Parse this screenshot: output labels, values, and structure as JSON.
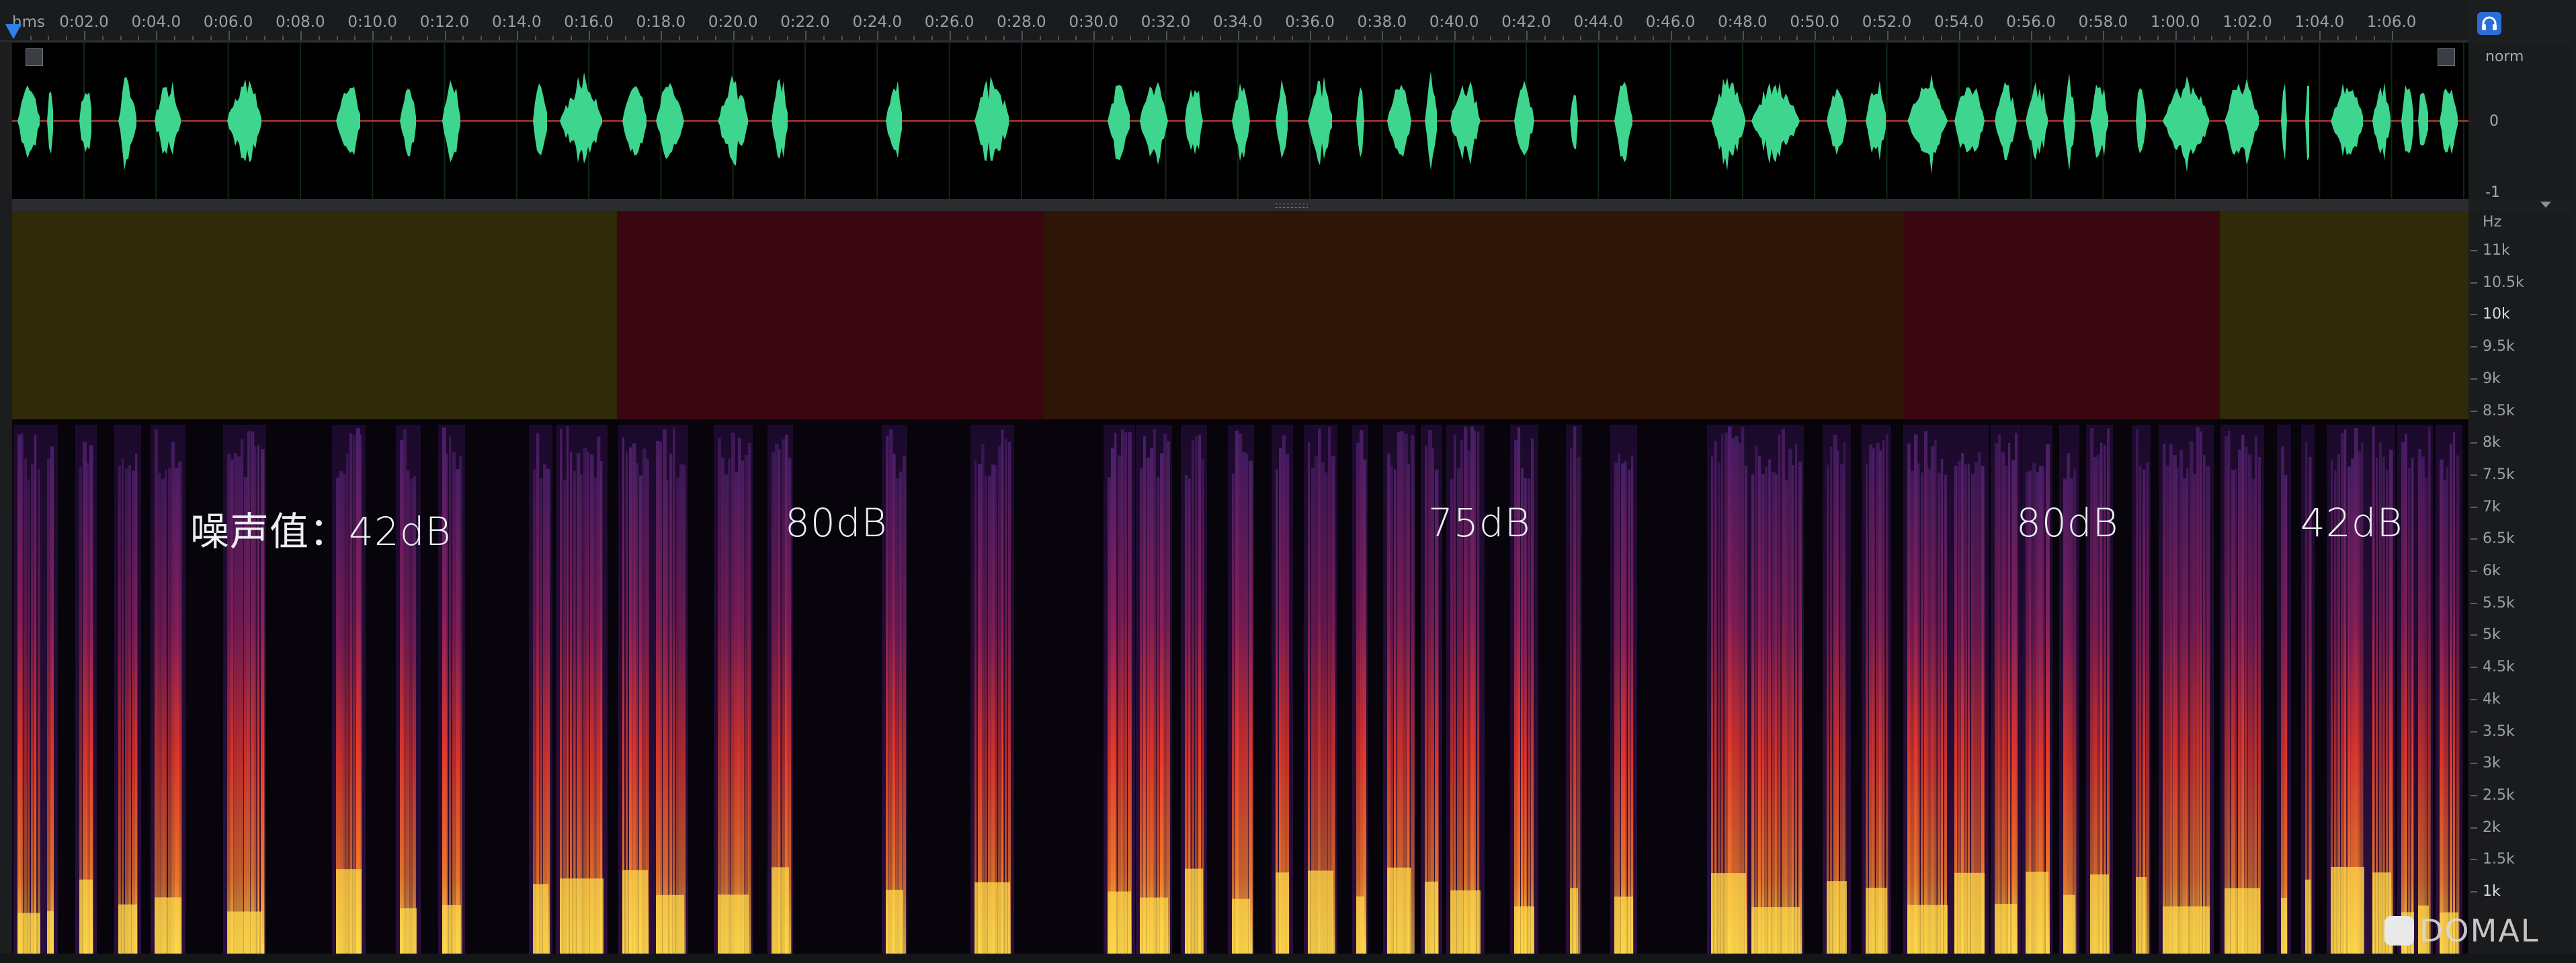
{
  "ruler": {
    "units": "hms",
    "ticks": [
      "0:02.0",
      "0:04.0",
      "0:06.0",
      "0:08.0",
      "0:10.0",
      "0:12.0",
      "0:14.0",
      "0:16.0",
      "0:18.0",
      "0:20.0",
      "0:22.0",
      "0:24.0",
      "0:26.0",
      "0:28.0",
      "0:30.0",
      "0:32.0",
      "0:34.0",
      "0:36.0",
      "0:38.0",
      "0:40.0",
      "0:42.0",
      "0:44.0",
      "0:46.0",
      "0:48.0",
      "0:50.0",
      "0:52.0",
      "0:54.0",
      "0:56.0",
      "0:58.0",
      "1:00.0",
      "1:02.0",
      "1:04.0",
      "1:06.0"
    ]
  },
  "waveform_scale": {
    "top": "norm",
    "middle": "0",
    "bottom": "-1"
  },
  "spectrogram_scale": {
    "unit": "Hz",
    "labels": [
      "11k",
      "10.5k",
      "10k",
      "9.5k",
      "9k",
      "8.5k",
      "8k",
      "7.5k",
      "7k",
      "6.5k",
      "6k",
      "5.5k",
      "5k",
      "4.5k",
      "4k",
      "3.5k",
      "3k",
      "2.5k",
      "2k",
      "1.5k",
      "1k"
    ]
  },
  "noise_zones": [
    {
      "label": "噪声值：42dB",
      "color": "#2f2a07"
    },
    {
      "label": "80dB",
      "color": "#3a0710"
    },
    {
      "label": "75dB",
      "color": "#2f1506"
    },
    {
      "label": "80dB",
      "color": "#3a0710"
    },
    {
      "label": "42dB",
      "color": "#2f2a07"
    }
  ],
  "colors": {
    "waveform": "#3ed68e",
    "center_line": "#c0392b",
    "spectrum_bright": "#ffd84a",
    "spectrum_mid": "#e8382a",
    "spectrum_low": "#4a1f6b",
    "accent": "#2f80ed"
  },
  "icons": {
    "headphones": "headphones-icon",
    "playhead": "playhead-marker-icon",
    "expand_left": "corner-expand-left-icon",
    "expand_right": "corner-expand-right-icon"
  },
  "watermark": {
    "text": "DOMAL"
  }
}
